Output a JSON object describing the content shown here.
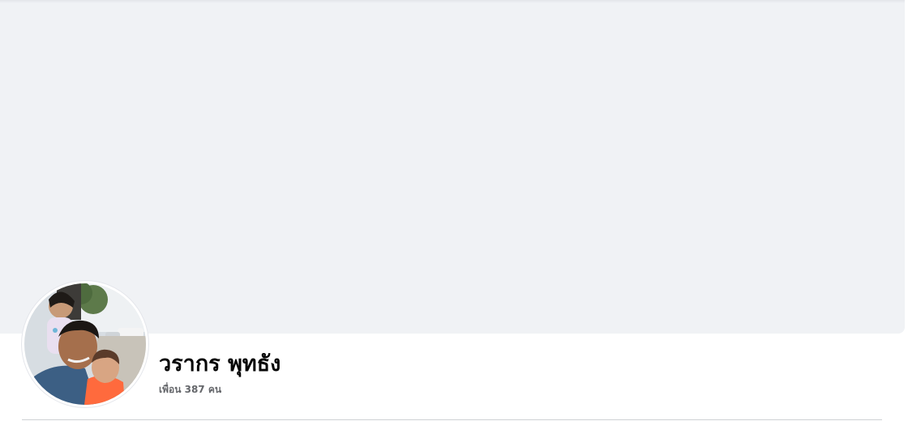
{
  "profile": {
    "name": "วรากร พุทธัง",
    "friends": "เพื่อน 387 คน"
  },
  "colors": {
    "cover_background": "#f0f2f5",
    "name_text": "#050505",
    "secondary_text": "#65676b",
    "divider": "#ced0d4"
  }
}
